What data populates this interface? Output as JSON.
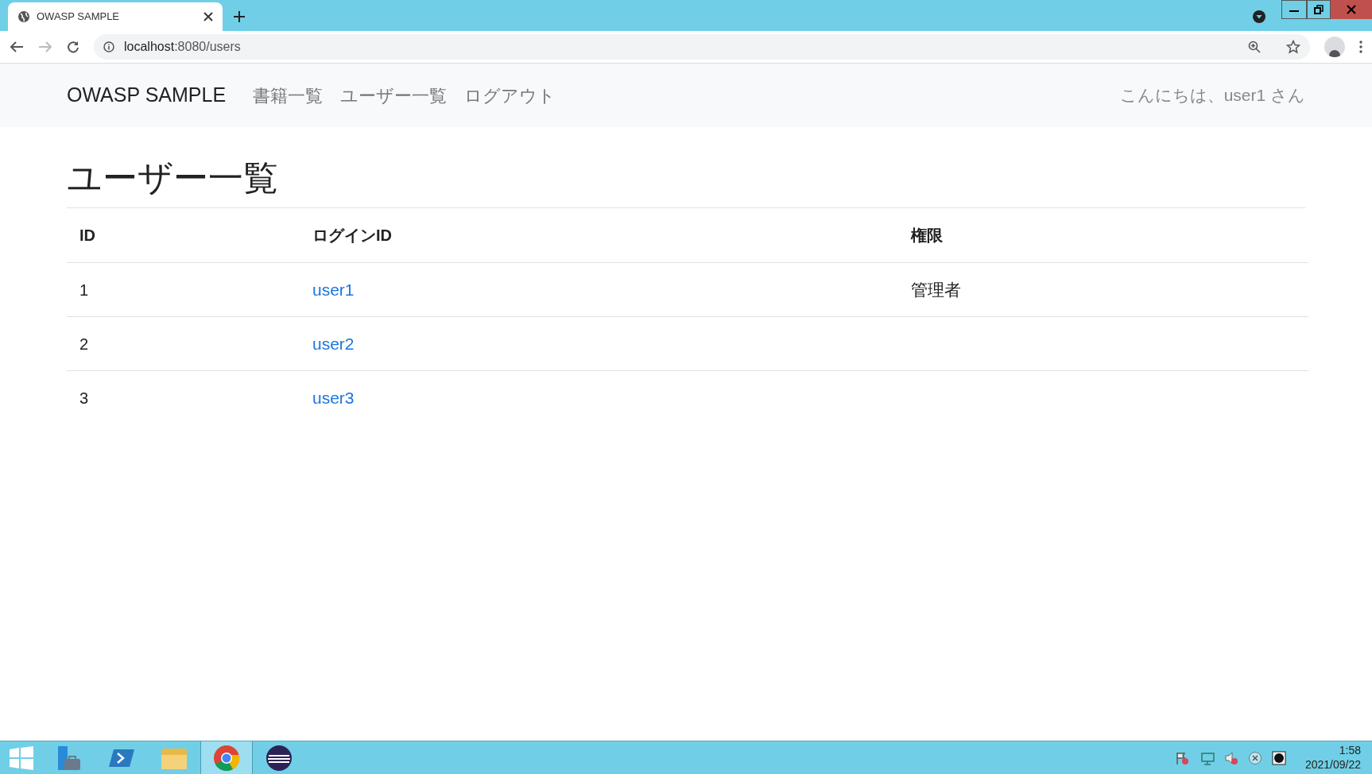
{
  "browser": {
    "tab_title": "OWASP SAMPLE",
    "url_host": "localhost",
    "url_path": ":8080/users"
  },
  "navbar": {
    "brand": "OWASP SAMPLE",
    "links": [
      "書籍一覧",
      "ユーザー一覧",
      "ログアウト"
    ],
    "greeting": "こんにちは、user1 さん"
  },
  "page": {
    "heading": "ユーザー一覧"
  },
  "table": {
    "columns": [
      "ID",
      "ログインID",
      "権限"
    ],
    "rows": [
      {
        "id": "1",
        "login_id": "user1",
        "role": "管理者"
      },
      {
        "id": "2",
        "login_id": "user2",
        "role": ""
      },
      {
        "id": "3",
        "login_id": "user3",
        "role": ""
      }
    ]
  },
  "taskbar": {
    "apps": [
      {
        "kind": "server",
        "selected": false
      },
      {
        "kind": "shell",
        "selected": false
      },
      {
        "kind": "folder",
        "selected": false
      },
      {
        "kind": "chrome",
        "selected": true
      },
      {
        "kind": "eclipse",
        "selected": false
      }
    ],
    "time": "1:58",
    "date": "2021/09/22"
  }
}
